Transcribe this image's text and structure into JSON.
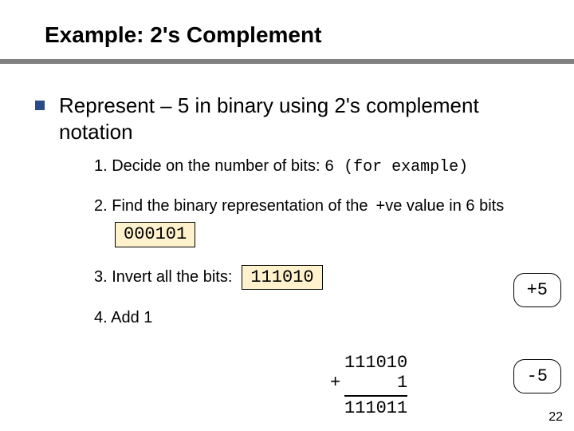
{
  "title": "Example: 2's Complement",
  "main": "Represent – 5 in binary using 2's complement notation",
  "steps": {
    "s1_label": "1. Decide on the number of bits:",
    "s1_value": "6 (for example)",
    "s2a": "2. Find the binary representation of the",
    "s2b": "+ve value in 6 bits",
    "s2_value": "000101",
    "s3_label": "3. Invert all the bits:",
    "s3_value": "111010",
    "s4_label": "4. Add 1"
  },
  "addition": {
    "a": "111010",
    "b": "1",
    "sum": "111011",
    "plus": "+"
  },
  "callouts": {
    "pos": "+5",
    "neg": "-5"
  },
  "page": "22"
}
